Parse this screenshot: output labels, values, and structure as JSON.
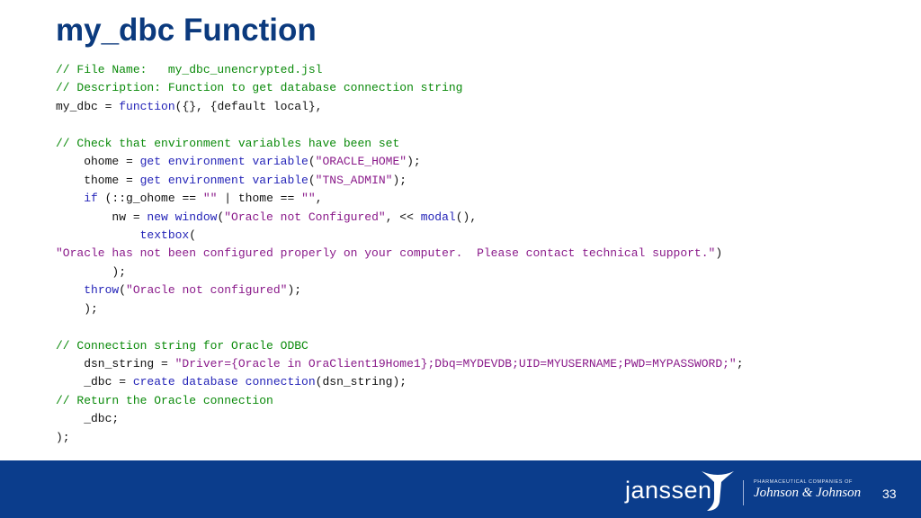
{
  "slide": {
    "title": "my_dbc Function",
    "page_number": "33"
  },
  "colors": {
    "title": "#0b3a7e",
    "comment": "#0a8a0a",
    "keyword": "#2424b8",
    "string": "#8a1a8a",
    "footer": "#0b3d8c"
  },
  "code": {
    "lines": [
      [
        [
          "comment",
          "// File Name:   my_dbc_unencrypted.jsl"
        ]
      ],
      [
        [
          "comment",
          "// Description: Function to get database connection string"
        ]
      ],
      [
        [
          "plain",
          "my_dbc = "
        ],
        [
          "kw",
          "function"
        ],
        [
          "plain",
          "({}, {default local},"
        ]
      ],
      [],
      [
        [
          "comment",
          "// Check that environment variables have been set"
        ]
      ],
      [
        [
          "plain",
          "    ohome = "
        ],
        [
          "kw",
          "get environment variable"
        ],
        [
          "plain",
          "("
        ],
        [
          "str",
          "\"ORACLE_HOME\""
        ],
        [
          "plain",
          ");"
        ]
      ],
      [
        [
          "plain",
          "    thome = "
        ],
        [
          "kw",
          "get environment variable"
        ],
        [
          "plain",
          "("
        ],
        [
          "str",
          "\"TNS_ADMIN\""
        ],
        [
          "plain",
          ");"
        ]
      ],
      [
        [
          "plain",
          "    "
        ],
        [
          "kw",
          "if"
        ],
        [
          "plain",
          " (::g_ohome == "
        ],
        [
          "str",
          "\"\""
        ],
        [
          "plain",
          " | thome == "
        ],
        [
          "str",
          "\"\""
        ],
        [
          "plain",
          ","
        ]
      ],
      [
        [
          "plain",
          "        nw = "
        ],
        [
          "kw",
          "new window"
        ],
        [
          "plain",
          "("
        ],
        [
          "str",
          "\"Oracle not Configured\""
        ],
        [
          "plain",
          ", << "
        ],
        [
          "kw",
          "modal"
        ],
        [
          "plain",
          "(),"
        ]
      ],
      [
        [
          "plain",
          "            "
        ],
        [
          "kw",
          "textbox"
        ],
        [
          "plain",
          "("
        ]
      ],
      [
        [
          "str",
          "\"Oracle has not been configured properly on your computer.  Please contact technical support.\""
        ],
        [
          "plain",
          ")"
        ]
      ],
      [
        [
          "plain",
          "        );"
        ]
      ],
      [
        [
          "plain",
          "    "
        ],
        [
          "kw",
          "throw"
        ],
        [
          "plain",
          "("
        ],
        [
          "str",
          "\"Oracle not configured\""
        ],
        [
          "plain",
          ");"
        ]
      ],
      [
        [
          "plain",
          "    );"
        ]
      ],
      [],
      [
        [
          "comment",
          "// Connection string for Oracle ODBC"
        ]
      ],
      [
        [
          "plain",
          "    dsn_string = "
        ],
        [
          "str",
          "\"Driver={Oracle in OraClient19Home1};Dbq=MYDEVDB;UID=MYUSERNAME;PWD=MYPASSWORD;\""
        ],
        [
          "plain",
          ";"
        ]
      ],
      [
        [
          "plain",
          "    _dbc = "
        ],
        [
          "kw",
          "create database connection"
        ],
        [
          "plain",
          "(dsn_string);"
        ]
      ],
      [
        [
          "comment",
          "// Return the Oracle connection"
        ]
      ],
      [
        [
          "plain",
          "    _dbc;"
        ]
      ],
      [
        [
          "plain",
          ");"
        ]
      ]
    ]
  },
  "footer": {
    "brand": "janssen",
    "tagline": "PHARMACEUTICAL COMPANIES OF",
    "parent_logo": "Johnson & Johnson"
  }
}
